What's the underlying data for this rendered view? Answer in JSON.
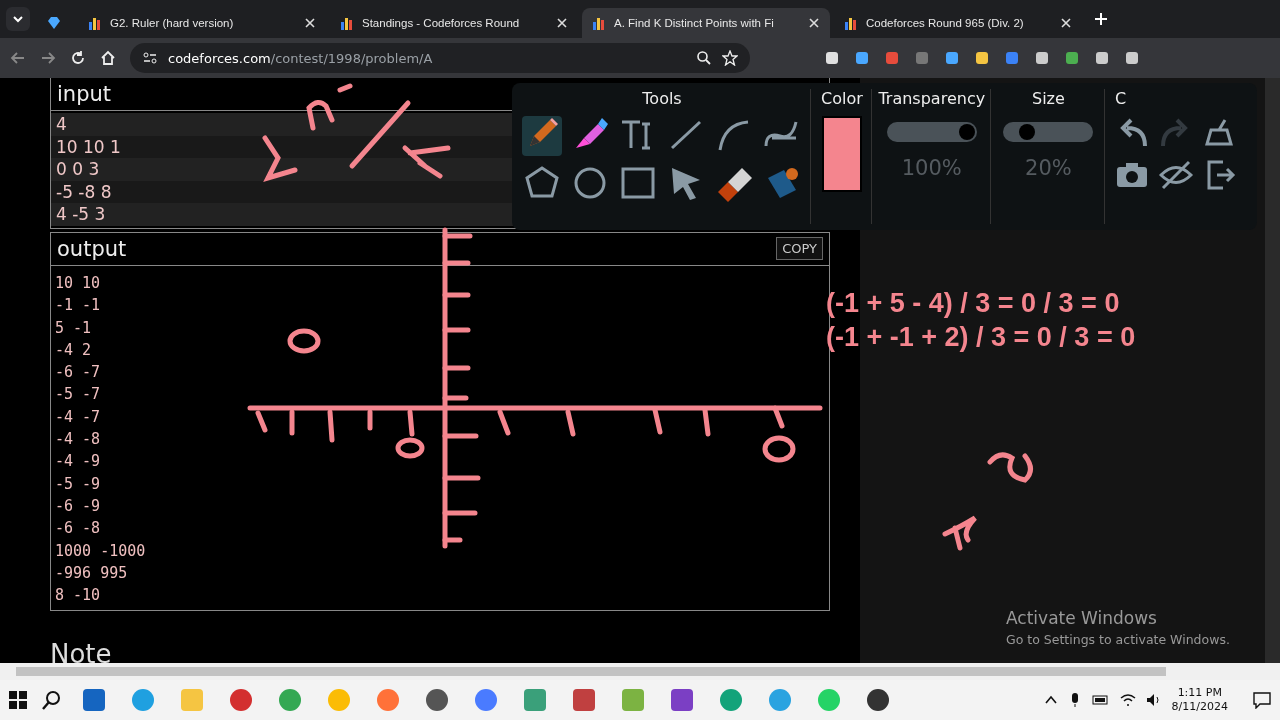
{
  "browser": {
    "tabs": [
      {
        "title": "G2. Ruler (hard version)",
        "selected": false
      },
      {
        "title": "Standings - Codeforces Round",
        "selected": false
      },
      {
        "title": "A. Find K Distinct Points with Fi",
        "selected": true
      },
      {
        "title": "Codeforces Round 965 (Div. 2)",
        "selected": false
      }
    ],
    "address": {
      "domain": "codeforces.com",
      "path": "/contest/1998/problem/A"
    }
  },
  "problem": {
    "input": {
      "title": "input",
      "lines": [
        "4",
        "10 10 1",
        "0 0 3",
        "-5 -8 8",
        "4 -5 3"
      ]
    },
    "output": {
      "title": "output",
      "copy": "COPY",
      "lines": [
        "10 10",
        "-1 -1",
        "5 -1",
        "-4 2",
        "-6 -7",
        "-5 -7",
        "-4 -7",
        "-4 -8",
        "-4 -9",
        "-5 -9",
        "-6 -9",
        "-6 -8",
        "1000 -1000",
        "-996 995",
        "8 -10"
      ]
    },
    "note": "Note"
  },
  "tools_panel": {
    "tools_title": "Tools",
    "tools": [
      {
        "kind": "pencil",
        "selected": true
      },
      {
        "kind": "marker",
        "selected": false
      },
      {
        "kind": "text",
        "selected": false
      },
      {
        "kind": "line",
        "selected": false
      },
      {
        "kind": "arc",
        "selected": false
      },
      {
        "kind": "curve",
        "selected": false
      },
      {
        "kind": "polygon",
        "selected": false
      },
      {
        "kind": "circle",
        "selected": false
      },
      {
        "kind": "rectangle",
        "selected": false
      },
      {
        "kind": "pointer",
        "selected": false
      },
      {
        "kind": "eraser",
        "selected": false
      },
      {
        "kind": "fill",
        "selected": false
      }
    ],
    "color_title": "Color",
    "color": "#f4858e",
    "transparency": {
      "title": "Transparency",
      "level": 1,
      "reading": "100%"
    },
    "size": {
      "title": "Size",
      "level": 0.2,
      "reading": "20%"
    },
    "column_5": {
      "title": "C"
    }
  },
  "annotations": {
    "lines": [
      "(-1 + 5 - 4) / 3 = 0 / 3 = 0",
      "(-1 + -1 + 2) / 3 = 0 / 3 = 0"
    ]
  },
  "activation": {
    "title": "Activate Windows",
    "subtitle": "Go to Settings to activate Windows."
  },
  "taskbar": {
    "time": "1:11 PM",
    "date": "8/11/2024"
  }
}
